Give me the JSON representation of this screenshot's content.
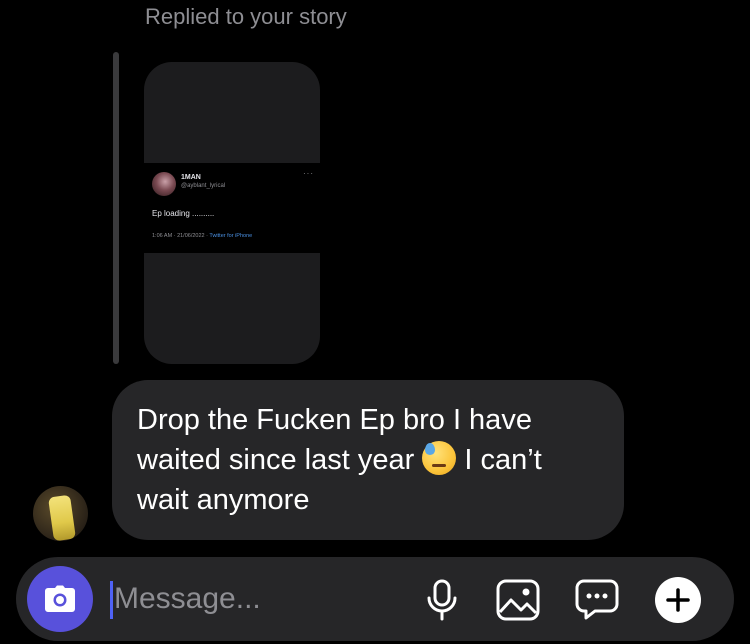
{
  "thread": {
    "reply_label": "Replied to your story"
  },
  "story_preview": {
    "tweet": {
      "name": "1MAN",
      "handle": "@ayblant_lyrical",
      "text": "Ep loading ..........",
      "timestamp": "1:06 AM · 21/06/2022 ·",
      "source": "Twitter for iPhone"
    }
  },
  "message": {
    "text_before_emoji": "Drop the Fucken Ep bro I have waited since last year",
    "emoji": "downcast-face-with-sweat",
    "text_after_emoji": "I can’t wait anymore"
  },
  "composer": {
    "placeholder": "Message...",
    "value": ""
  },
  "icons": {
    "camera": "camera-icon",
    "mic": "microphone-icon",
    "gallery": "gallery-icon",
    "sticker": "sticker-chat-icon",
    "add": "plus-icon"
  },
  "colors": {
    "background": "#000000",
    "bubble": "#262628",
    "accent": "#5851db",
    "caret": "#4f62f5",
    "secondary_text": "#8e8e93"
  }
}
